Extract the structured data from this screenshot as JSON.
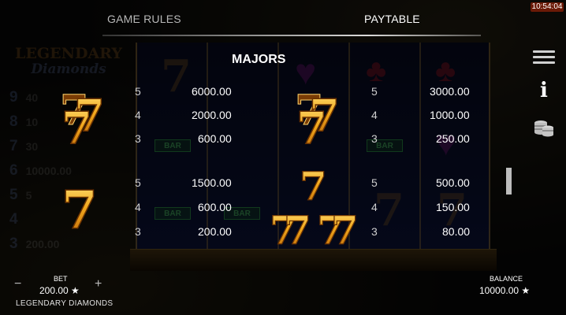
{
  "clock": "10:54:04",
  "tabs": {
    "rules": "GAME RULES",
    "paytable": "PAYTABLE"
  },
  "section_title": "MAJORS",
  "background": {
    "logo_line1": "LEGENDARY",
    "logo_line2": "Diamonds",
    "ladder": [
      {
        "num": "9",
        "val": "40"
      },
      {
        "num": "8",
        "val": "10"
      },
      {
        "num": "7",
        "val": "30"
      },
      {
        "num": "6",
        "val": "10000.00"
      },
      {
        "num": "5",
        "val": "5"
      },
      {
        "num": "4",
        "val": ""
      },
      {
        "num": "3",
        "val": "200.00"
      }
    ],
    "bar_label": "BAR"
  },
  "paytable": {
    "group1": {
      "left": [
        {
          "count": "5",
          "value": "6000.00"
        },
        {
          "count": "4",
          "value": "2000.00"
        },
        {
          "count": "3",
          "value": "600.00"
        }
      ],
      "right": [
        {
          "count": "5",
          "value": "3000.00"
        },
        {
          "count": "4",
          "value": "1000.00"
        },
        {
          "count": "3",
          "value": "250.00"
        }
      ]
    },
    "group2": {
      "left": [
        {
          "count": "5",
          "value": "1500.00"
        },
        {
          "count": "4",
          "value": "600.00"
        },
        {
          "count": "3",
          "value": "200.00"
        }
      ],
      "right": [
        {
          "count": "5",
          "value": "500.00"
        },
        {
          "count": "4",
          "value": "150.00"
        },
        {
          "count": "3",
          "value": "80.00"
        }
      ]
    },
    "symbol_glyph": "7"
  },
  "footer": {
    "bet_label": "BET",
    "bet_value": "200.00 ★",
    "minus": "−",
    "plus": "+",
    "game_name": "LEGENDARY DIAMONDS",
    "balance_label": "BALANCE",
    "balance_value": "10000.00 ★"
  },
  "menu": {
    "info_glyph": "i"
  },
  "scroll_position": 0.69,
  "colors": {
    "gold": "#f2a81c",
    "gold_dark": "#a85a08",
    "clock_bg": "#6b1a06"
  }
}
